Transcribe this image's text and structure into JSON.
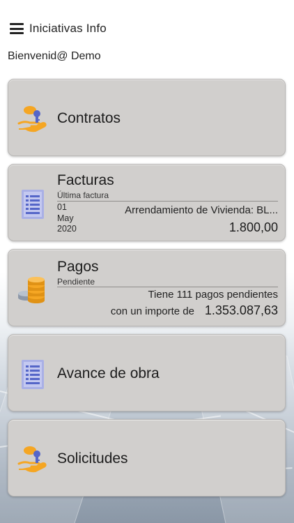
{
  "header": {
    "title": "Iniciativas Info"
  },
  "welcome": "Bienvenid@ Demo",
  "cards": {
    "contratos": {
      "label": "Contratos"
    },
    "facturas": {
      "label": "Facturas",
      "sublabel": "Última factura",
      "day": "01",
      "month": "May",
      "year": "2020",
      "description": "Arrendamiento de Vivienda: BL...",
      "amount": "1.800,00"
    },
    "pagos": {
      "label": "Pagos",
      "sublabel": "Pendiente",
      "line1": "Tiene 111 pagos pendientes",
      "line2_prefix": "con un importe de",
      "amount": "1.353.087,63"
    },
    "avance": {
      "label": "Avance de obra"
    },
    "solicitudes": {
      "label": "Solicitudes"
    }
  },
  "colors": {
    "card_bg": "#d1cfcd",
    "icon_orange": "#f5a623",
    "icon_blue": "#5566c8"
  },
  "icons": {
    "contratos": "hand-key-icon",
    "facturas": "document-icon",
    "pagos": "coins-icon",
    "avance": "document-icon",
    "solicitudes": "hand-key-icon"
  }
}
